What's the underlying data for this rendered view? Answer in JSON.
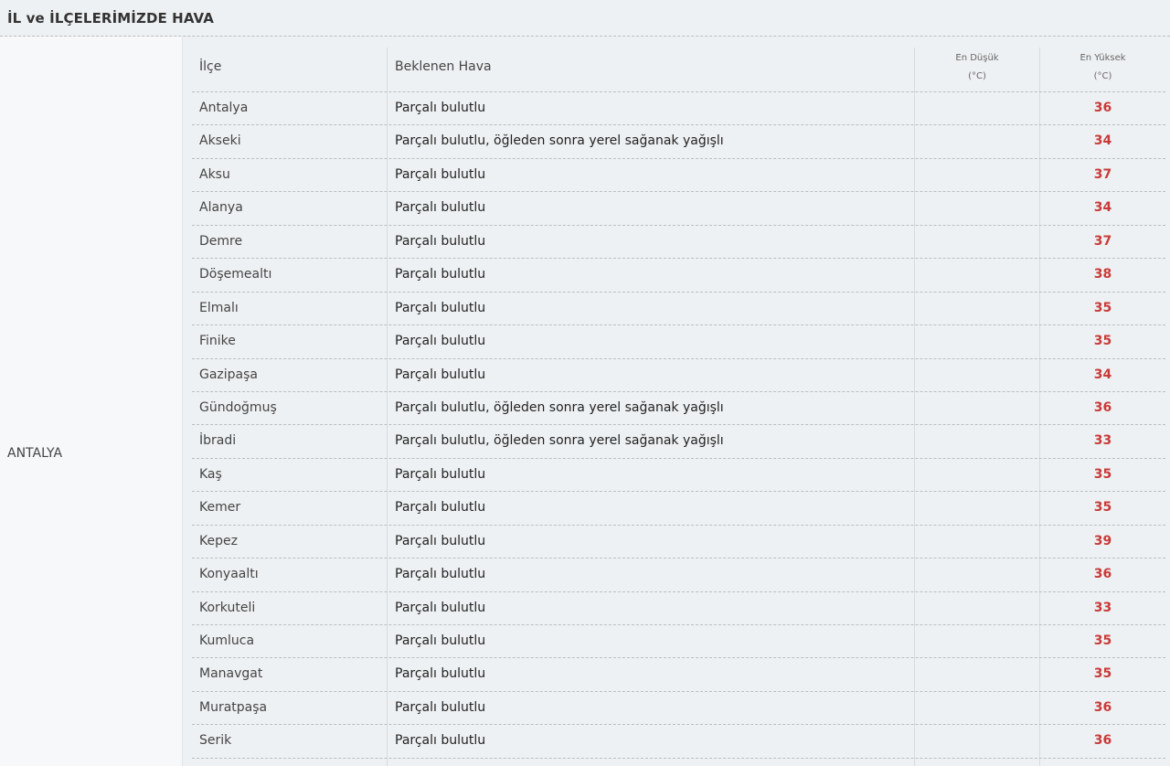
{
  "header": {
    "title": "İL ve İLÇELERİMİZDE HAVA"
  },
  "province": "ANTALYA",
  "columns": {
    "district": "İlçe",
    "weather": "Beklenen Hava",
    "min_line1": "En Düşük",
    "min_line2": "(°C)",
    "max_line1": "En Yüksek",
    "max_line2": "(°C)"
  },
  "rows": [
    {
      "district": "Antalya",
      "weather": "Parçalı bulutlu",
      "max": "36"
    },
    {
      "district": "Akseki",
      "weather": "Parçalı bulutlu, öğleden sonra yerel sağanak yağışlı",
      "max": "34"
    },
    {
      "district": "Aksu",
      "weather": "Parçalı bulutlu",
      "max": "37"
    },
    {
      "district": "Alanya",
      "weather": "Parçalı bulutlu",
      "max": "34"
    },
    {
      "district": "Demre",
      "weather": "Parçalı bulutlu",
      "max": "37"
    },
    {
      "district": "Döşemealtı",
      "weather": "Parçalı bulutlu",
      "max": "38"
    },
    {
      "district": "Elmalı",
      "weather": "Parçalı bulutlu",
      "max": "35"
    },
    {
      "district": "Finike",
      "weather": "Parçalı bulutlu",
      "max": "35"
    },
    {
      "district": "Gazipaşa",
      "weather": "Parçalı bulutlu",
      "max": "34"
    },
    {
      "district": "Gündoğmuş",
      "weather": "Parçalı bulutlu, öğleden sonra yerel sağanak yağışlı",
      "max": "36"
    },
    {
      "district": "İbradi",
      "weather": "Parçalı bulutlu, öğleden sonra yerel sağanak yağışlı",
      "max": "33"
    },
    {
      "district": "Kaş",
      "weather": "Parçalı bulutlu",
      "max": "35"
    },
    {
      "district": "Kemer",
      "weather": "Parçalı bulutlu",
      "max": "35"
    },
    {
      "district": "Kepez",
      "weather": "Parçalı bulutlu",
      "max": "39"
    },
    {
      "district": "Konyaaltı",
      "weather": "Parçalı bulutlu",
      "max": "36"
    },
    {
      "district": "Korkuteli",
      "weather": "Parçalı bulutlu",
      "max": "33"
    },
    {
      "district": "Kumluca",
      "weather": "Parçalı bulutlu",
      "max": "35"
    },
    {
      "district": "Manavgat",
      "weather": "Parçalı bulutlu",
      "max": "35"
    },
    {
      "district": "Muratpaşa",
      "weather": "Parçalı bulutlu",
      "max": "36"
    },
    {
      "district": "Serik",
      "weather": "Parçalı bulutlu",
      "max": "36"
    }
  ]
}
